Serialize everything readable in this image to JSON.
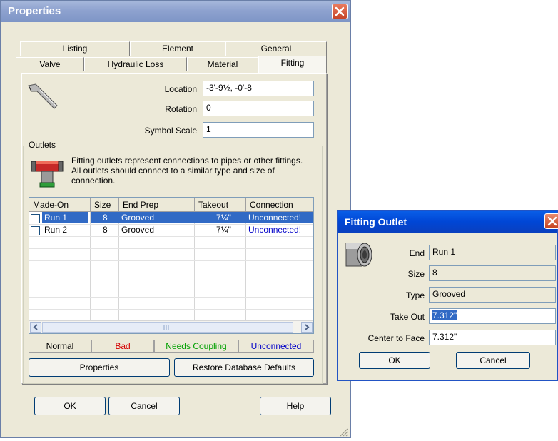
{
  "properties": {
    "title": "Properties",
    "tabs_row1": [
      "Listing",
      "Element",
      "General"
    ],
    "tabs_row2": [
      "Valve",
      "Hydraulic Loss",
      "Material",
      "Fitting"
    ],
    "location_label": "Location",
    "location_value": "-3'-9½, -0'-8",
    "rotation_label": "Rotation",
    "rotation_value": "0",
    "symbol_scale_label": "Symbol Scale",
    "symbol_scale_value": "1",
    "outlets_label": "Outlets",
    "outlets_desc": "Fitting outlets represent connections to pipes or other fittings. All outlets should connect to a similar type and size of connection.",
    "columns": [
      "Made-On",
      "Size",
      "End Prep",
      "Takeout",
      "Connection"
    ],
    "rows": [
      {
        "name": "Run 1",
        "size": "8",
        "end_prep": "Grooved",
        "takeout": "7¼\"",
        "connection": "Unconnected!"
      },
      {
        "name": "Run 2",
        "size": "8",
        "end_prep": "Grooved",
        "takeout": "7¼\"",
        "connection": "Unconnected!"
      }
    ],
    "legend": {
      "normal": "Normal",
      "bad": "Bad",
      "needs_coupling": "Needs Coupling",
      "unconnected": "Unconnected"
    },
    "properties_button": "Properties",
    "restore_button": "Restore Database Defaults",
    "ok": "OK",
    "cancel": "Cancel",
    "help": "Help"
  },
  "fitting_outlet": {
    "title": "Fitting Outlet",
    "end_label": "End",
    "end_value": "Run 1",
    "size_label": "Size",
    "size_value": "8",
    "type_label": "Type",
    "type_value": "Grooved",
    "takeout_label": "Take Out",
    "takeout_value": "7.312\"",
    "center_label": "Center to Face",
    "center_value": "7.312\"",
    "ok": "OK",
    "cancel": "Cancel"
  },
  "colors": {
    "selection": "#316ac5",
    "bad": "#d40000",
    "needs_coupling": "#00a000",
    "unconnected": "#0000c8"
  }
}
